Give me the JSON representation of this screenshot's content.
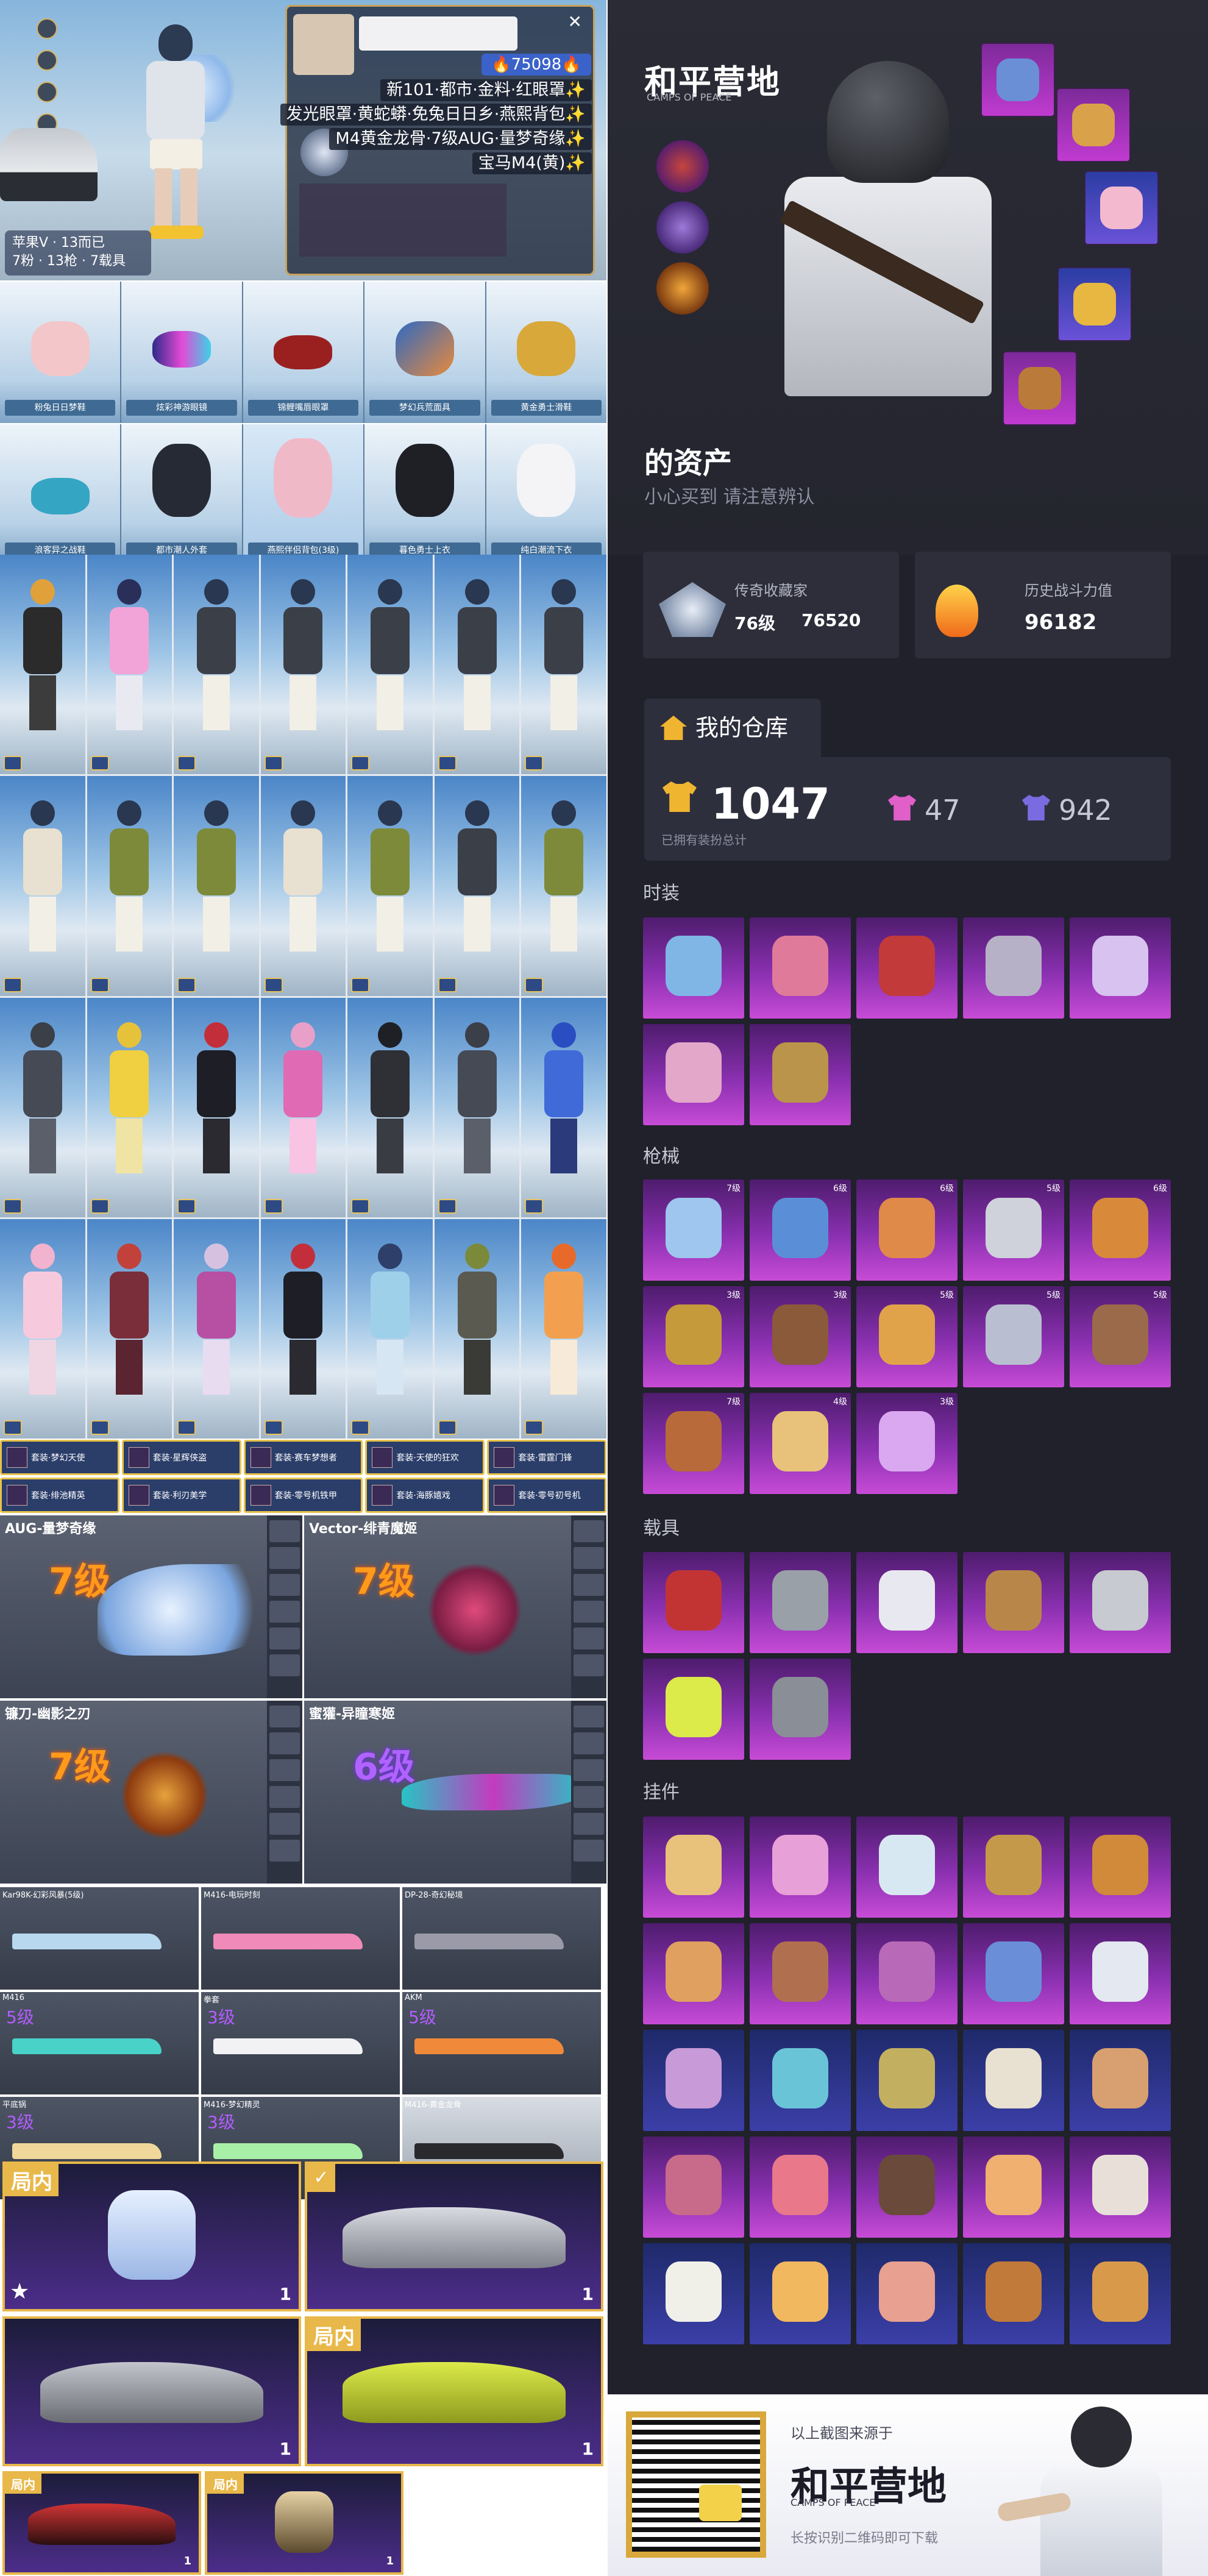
{
  "left": {
    "hero": {
      "account_line1": "苹果V · 13而已",
      "account_line2": "7粉 · 13枪 · 7载具",
      "fire_count": "🔥75098🔥",
      "feature_lines": [
        "新101·都市·金料·红眼罩✨",
        "发光眼罩·黄蛇蟒·免兔日日乡·燕熙背包✨",
        "M4黄金龙骨·7级AUG·量梦奇缘✨",
        "宝马M4(黄)✨"
      ]
    },
    "row1_captions": [
      "粉兔日日梦鞋",
      "炫彩神游眼镜",
      "锦鲤嘴唇眼罩",
      "梦幻兵荒面具",
      "黄金勇士滑鞋"
    ],
    "row2_captions": [
      "浪客异之战鞋",
      "都市潮人外套",
      "燕熙伴侣背包(3级)",
      "暮色勇士上衣",
      "纯白潮流下衣"
    ],
    "titles": [
      "套装·梦幻天使",
      "套装·星辉侠盗",
      "套装·赛车梦想者",
      "套装·天使的狂欢",
      "套装·雷霆门锋",
      "套装·绯池精英",
      "套装·利刃美学",
      "套装·零号机铁甲",
      "套装·海豚嬉戏",
      "套装·零号初号机"
    ],
    "weapons_big": [
      {
        "title": "AUG-量梦奇缘",
        "level": "7级"
      },
      {
        "title": "Vector-绯青魔姬",
        "level": "7级"
      },
      {
        "title": "镰刀-幽影之刃",
        "level": "7级"
      },
      {
        "title": "蜜獾-异瞳寒姬",
        "level": "6级"
      }
    ],
    "weapons_small": [
      {
        "title": "Kar98K-幻彩风暴(5级)",
        "level": ""
      },
      {
        "title": "M416-电玩时刻",
        "level": ""
      },
      {
        "title": "DP-28-奇幻秘境",
        "level": ""
      },
      {
        "title": "M416",
        "level": "5级"
      },
      {
        "title": "拳套",
        "level": "3级"
      },
      {
        "title": "AKM",
        "level": "5级"
      },
      {
        "title": "平底锅",
        "level": "3级"
      },
      {
        "title": "M416-梦幻精灵",
        "level": "3级"
      },
      {
        "title": "M416-黄金龙骨",
        "level": ""
      }
    ],
    "vehicles": [
      {
        "tag": "局内",
        "count": "1"
      },
      {
        "tag": "✓",
        "count": "1"
      },
      {
        "tag": "",
        "count": "1"
      },
      {
        "tag": "局内",
        "count": "1"
      },
      {
        "tag": "局内",
        "count": "1"
      },
      {
        "tag": "局内",
        "count": "1"
      }
    ]
  },
  "right": {
    "logo": "和平营地",
    "logo_sub": "CAMPS OF PEACE",
    "title": "的资产",
    "subtitle": "小心买到 请注意辨认",
    "stat1_label": "传奇收藏家",
    "stat1_level": "76级",
    "stat1_value": "76520",
    "stat2_label": "历史战斗力值",
    "stat2_value": "96182",
    "tab_label": "我的仓库",
    "warehouse_total": "1047",
    "warehouse_total_sub": "已拥有装扮总计",
    "warehouse_a": "47",
    "warehouse_b": "942",
    "sections": {
      "fashion": "时装",
      "guns": "枪械",
      "vehicles": "载具",
      "items": "挂件"
    },
    "gun_counts": [
      "7级",
      "6级",
      "6级",
      "5级",
      "6级",
      "3级",
      "3级",
      "5级",
      "5级",
      "5级",
      "7级",
      "4级",
      "3级"
    ],
    "promo_top": "以上截图来源于",
    "promo_logo": "和平营地",
    "promo_logo_sub": "CAMPS OF PEACE",
    "promo_bottom": "长按识别二维码即可下载"
  },
  "colors": {
    "accent_gold": "#e8b84a",
    "purple_tile": "#8a30b0",
    "right_bg": "#20212a"
  }
}
